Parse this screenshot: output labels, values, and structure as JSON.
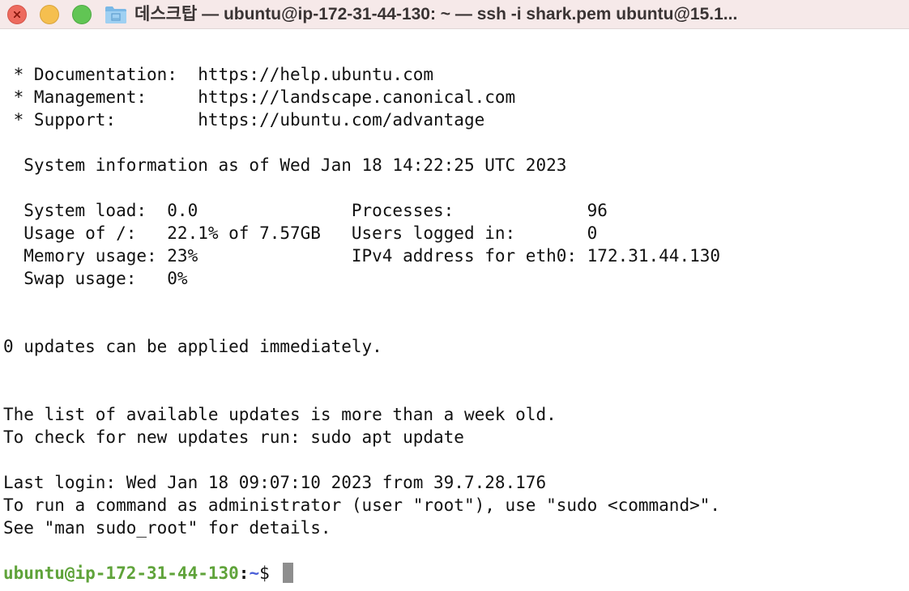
{
  "window": {
    "title": "데스크탑 — ubuntu@ip-172-31-44-130: ~ — ssh -i shark.pem ubuntu@15.1...",
    "folder_icon": "folder-icon",
    "colors": {
      "titlebar": "#f6e9e9",
      "close": "#ed6a5e",
      "minimize": "#f5bf4f",
      "zoom": "#61c554"
    }
  },
  "terminal": {
    "lines": [
      " * Documentation:  https://help.ubuntu.com",
      " * Management:     https://landscape.canonical.com",
      " * Support:        https://ubuntu.com/advantage",
      "",
      "  System information as of Wed Jan 18 14:22:25 UTC 2023",
      "",
      "  System load:  0.0               Processes:             96",
      "  Usage of /:   22.1% of 7.57GB   Users logged in:       0",
      "  Memory usage: 23%               IPv4 address for eth0: 172.31.44.130",
      "  Swap usage:   0%",
      "",
      "",
      "0 updates can be applied immediately.",
      "",
      "",
      "The list of available updates is more than a week old.",
      "To check for new updates run: sudo apt update",
      "",
      "Last login: Wed Jan 18 09:07:10 2023 from 39.7.28.176",
      "To run a command as administrator (user \"root\"), use \"sudo <command>\".",
      "See \"man sudo_root\" for details."
    ],
    "prompt": {
      "user_host": "ubuntu@ip-172-31-44-130",
      "separator": ":",
      "path": "~",
      "symbol": "$ "
    },
    "colors": {
      "text": "#111111",
      "prompt_user": "#5fa33a",
      "prompt_path": "#4b5fd8",
      "cursor": "#8e8e8e"
    }
  }
}
